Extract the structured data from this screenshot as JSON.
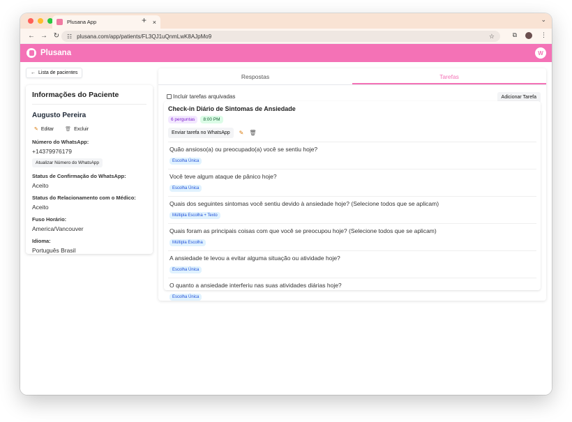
{
  "browser": {
    "tab_title": "Plusana App",
    "tab_close": "×",
    "new_tab": "+",
    "url": "plusana.com/app/patients/FL3QJ1uQnmLwK8AJpMo9"
  },
  "app": {
    "brand": "Plusana",
    "avatar_initial": "W"
  },
  "back": {
    "label": "Lista de pacientes",
    "arrow": "←"
  },
  "patient": {
    "section_title": "Informações do Paciente",
    "name": "Augusto Pereira",
    "edit_label": "Editar",
    "delete_label": "Excluir",
    "fields": [
      {
        "label": "Número do WhatsApp:",
        "value": "+14379976179"
      },
      {
        "label": "Status de Confirmação do WhatsApp:",
        "value": "Aceito"
      },
      {
        "label": "Status do Relacionamento com o Médico:",
        "value": "Aceito"
      },
      {
        "label": "Fuso Horário:",
        "value": "America/Vancouver"
      },
      {
        "label": "Idioma:",
        "value": "Português Brasil"
      }
    ],
    "update_number_label": "Atualizar Número do WhatsApp"
  },
  "tabs": [
    {
      "label": "Respostas",
      "active": false
    },
    {
      "label": "Tarefas",
      "active": true
    }
  ],
  "filters": {
    "include_archived": "Incluir tarefas arquivadas",
    "add_task": "Adicionar Tarefa"
  },
  "task": {
    "title": "Check-in Diário de Sintomas de Ansiedade",
    "questions_badge": "6 perguntas",
    "time_badge": "8:00 PM",
    "send_whatsapp": "Enviar tarefa no WhatsApp",
    "questions": [
      {
        "text": "Quão ansioso(a) ou preocupado(a) você se sentiu hoje?",
        "type": "Escolha Única"
      },
      {
        "text": "Você teve algum ataque de pânico hoje?",
        "type": "Escolha Única"
      },
      {
        "text": "Quais dos seguintes sintomas você sentiu devido à ansiedade hoje? (Selecione todos que se aplicam)",
        "type": "Múltipla Escolha + Texto"
      },
      {
        "text": "Quais foram as principais coisas com que você se preocupou hoje? (Selecione todos que se aplicam)",
        "type": "Múltipla Escolha"
      },
      {
        "text": "A ansiedade te levou a evitar alguma situação ou atividade hoje?",
        "type": "Escolha Única"
      },
      {
        "text": "O quanto a ansiedade interferiu nas suas atividades diárias hoje?",
        "type": "Escolha Única"
      }
    ]
  },
  "colors": {
    "brand_pink": "#f472b6",
    "tabstrip": "#f9e3d4",
    "traffic_red": "#ff5f57",
    "traffic_yellow": "#febc2e",
    "traffic_green": "#28c840"
  }
}
